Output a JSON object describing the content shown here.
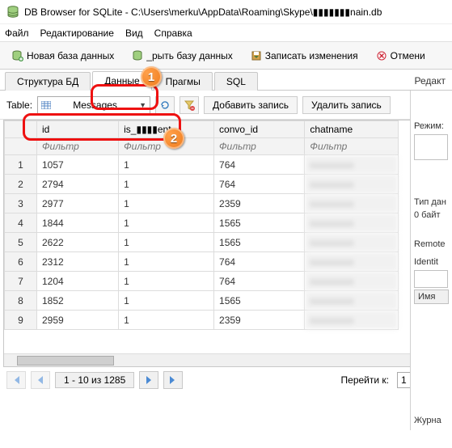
{
  "titlebar": {
    "title": "DB Browser for SQLite - C:\\Users\\merku\\AppData\\Roaming\\Skype\\▮▮▮▮▮▮▮nain.db"
  },
  "menu": {
    "file": "Файл",
    "edit": "Редактирование",
    "view": "Вид",
    "help": "Справка"
  },
  "toolbar": {
    "new_db": "Новая база данных",
    "open_db": "_рыть базу данных",
    "write": "Записать изменения",
    "undo": "Отмени"
  },
  "tabs": {
    "structure": "Структура БД",
    "data": "Данные",
    "pragmas": "Прагмы",
    "sql": "SQL",
    "right_edit": "Редакт"
  },
  "picker": {
    "label": "Table:",
    "value": "Messages",
    "add": "Добавить запись",
    "delete": "Удалить запись"
  },
  "grid": {
    "cols": [
      "id",
      "is_▮▮▮▮ent",
      "convo_id",
      "chatname"
    ],
    "filter_placeholder": "Фильтр",
    "rows": [
      {
        "n": "1",
        "id": "1057",
        "is": "1",
        "convo": "764"
      },
      {
        "n": "2",
        "id": "2794",
        "is": "1",
        "convo": "764"
      },
      {
        "n": "3",
        "id": "2977",
        "is": "1",
        "convo": "2359"
      },
      {
        "n": "4",
        "id": "1844",
        "is": "1",
        "convo": "1565"
      },
      {
        "n": "5",
        "id": "2622",
        "is": "1",
        "convo": "1565"
      },
      {
        "n": "6",
        "id": "2312",
        "is": "1",
        "convo": "764"
      },
      {
        "n": "7",
        "id": "1204",
        "is": "1",
        "convo": "764"
      },
      {
        "n": "8",
        "id": "1852",
        "is": "1",
        "convo": "1565"
      },
      {
        "n": "9",
        "id": "2959",
        "is": "1",
        "convo": "2359"
      }
    ]
  },
  "pagination": {
    "counter": "1 - 10 из 1285",
    "goto_label": "Перейти к:",
    "goto_value": "1"
  },
  "rpanel": {
    "mode": "Режим:",
    "type": "Тип дан",
    "bytes": "0 байт",
    "remote": "Remote",
    "identity": "Identit",
    "name": "Имя",
    "journal": "Журна"
  },
  "badges": {
    "one": "1",
    "two": "2"
  }
}
